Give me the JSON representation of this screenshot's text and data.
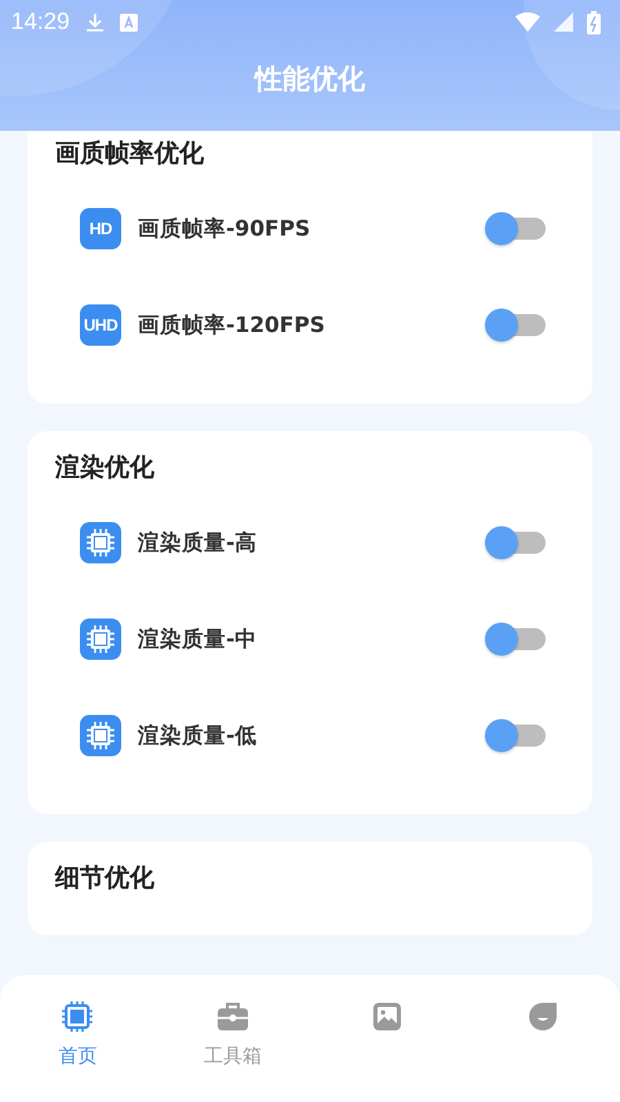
{
  "status_bar": {
    "time": "14:29"
  },
  "title": "性能优化",
  "sections": [
    {
      "heading": "画质帧率优化",
      "items": [
        {
          "kind": "badge",
          "badge": "HD",
          "label": "画质帧率-90FPS",
          "on": false
        },
        {
          "kind": "badge",
          "badge": "UHD",
          "label": "画质帧率-120FPS",
          "on": false
        }
      ]
    },
    {
      "heading": "渲染优化",
      "items": [
        {
          "kind": "chip",
          "label": "渲染质量-高",
          "on": false
        },
        {
          "kind": "chip",
          "label": "渲染质量-中",
          "on": false
        },
        {
          "kind": "chip",
          "label": "渲染质量-低",
          "on": false
        }
      ]
    },
    {
      "heading": "细节优化"
    }
  ],
  "tabs": [
    {
      "kind": "chip",
      "label": "首页",
      "selected": true
    },
    {
      "kind": "toolbox",
      "label": "工具箱",
      "selected": false
    },
    {
      "kind": "image",
      "selected": false
    },
    {
      "kind": "face",
      "selected": false
    }
  ]
}
